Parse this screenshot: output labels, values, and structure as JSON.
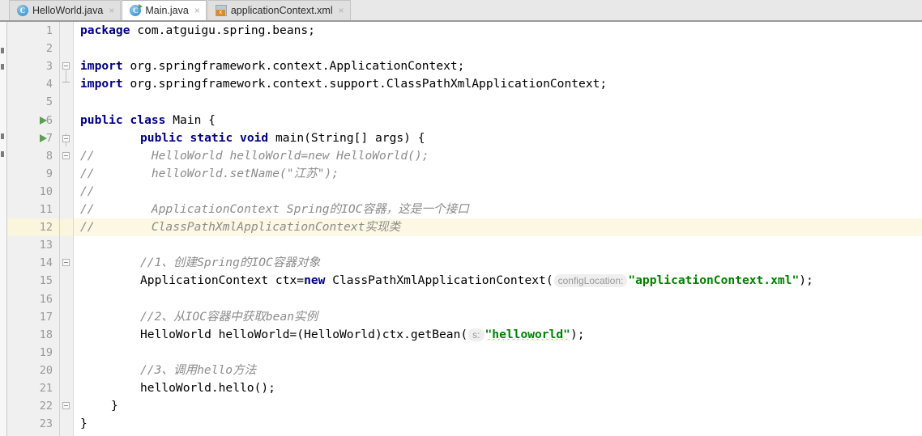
{
  "window": {
    "app": "IntelliJ IDEA Editor",
    "accent_keyword": "#000080",
    "accent_string": "#008000",
    "accent_comment": "#8c8c8c",
    "caret_line_color": "#fcf8e3",
    "run_marker_color": "#5c9e55"
  },
  "tabs": [
    {
      "label": "HelloWorld.java",
      "icon": "java-class-icon",
      "active": false,
      "close": "×"
    },
    {
      "label": "Main.java",
      "icon": "java-runnable-class-icon",
      "active": true,
      "close": "×"
    },
    {
      "label": "applicationContext.xml",
      "icon": "xml-file-icon",
      "active": false,
      "close": "×"
    }
  ],
  "editor": {
    "file": "Main.java",
    "caret_line": 12,
    "run_marker_lines": [
      6,
      7
    ],
    "line_numbers": [
      "1",
      "2",
      "3",
      "4",
      "5",
      "6",
      "7",
      "8",
      "9",
      "10",
      "11",
      "12",
      "13",
      "14",
      "15",
      "16",
      "17",
      "18",
      "19",
      "20",
      "21",
      "22",
      "23"
    ],
    "lines": [
      {
        "n": 1,
        "indent": 0,
        "text": "package com.atguigu.spring.beans;"
      },
      {
        "n": 2,
        "indent": 0,
        "text": ""
      },
      {
        "n": 3,
        "indent": 0,
        "text": "import org.springframework.context.ApplicationContext;"
      },
      {
        "n": 4,
        "indent": 0,
        "text": "import org.springframework.context.support.ClassPathXmlApplicationContext;"
      },
      {
        "n": 5,
        "indent": 0,
        "text": ""
      },
      {
        "n": 6,
        "indent": 0,
        "text": "public class Main {"
      },
      {
        "n": 7,
        "indent": 1,
        "text": "public static void main(String[] args) {"
      },
      {
        "n": 8,
        "indent": 0,
        "text": "//        HelloWorld helloWorld=new HelloWorld();"
      },
      {
        "n": 9,
        "indent": 0,
        "text": "//        helloWorld.setName(\"江苏\");"
      },
      {
        "n": 10,
        "indent": 0,
        "text": "//"
      },
      {
        "n": 11,
        "indent": 0,
        "text": "//        ApplicationContext Spring的IOC容器，这是一个接口"
      },
      {
        "n": 12,
        "indent": 0,
        "text": "//        ClassPathXmlApplicationContext实现类"
      },
      {
        "n": 13,
        "indent": 0,
        "text": ""
      },
      {
        "n": 14,
        "indent": 2,
        "text": "//1、创建Spring的IOC容器对象"
      },
      {
        "n": 15,
        "indent": 2,
        "text": "ApplicationContext ctx=new ClassPathXmlApplicationContext( configLocation: \"applicationContext.xml\");"
      },
      {
        "n": 16,
        "indent": 0,
        "text": ""
      },
      {
        "n": 17,
        "indent": 2,
        "text": "//2、从IOC容器中获取bean实例"
      },
      {
        "n": 18,
        "indent": 2,
        "text": "HelloWorld helloWorld=(HelloWorld)ctx.getBean( s: \"helloworld\");"
      },
      {
        "n": 19,
        "indent": 0,
        "text": ""
      },
      {
        "n": 20,
        "indent": 2,
        "text": "//3、调用hello方法"
      },
      {
        "n": 21,
        "indent": 2,
        "text": "helloWorld.hello();"
      },
      {
        "n": 22,
        "indent": 1,
        "text": "}"
      },
      {
        "n": 23,
        "indent": 0,
        "text": "}"
      }
    ],
    "tokens": {
      "kw_package": "package",
      "kw_import": "import",
      "kw_public": "public",
      "kw_class": "class",
      "kw_static": "static",
      "kw_void": "void",
      "kw_new": "new",
      "pkg_name": "com.atguigu.spring.beans;",
      "import1": "org.springframework.context.ApplicationContext;",
      "import2": "org.springframework.context.support.ClassPathXmlApplicationContext;",
      "class_name": "Main {",
      "main_sig": "main(String[] args) {",
      "cmt8": "//        HelloWorld helloWorld=new HelloWorld();",
      "cmt9": "//        helloWorld.setName(\"江苏\");",
      "cmt10": "//",
      "cmt11": "//        ApplicationContext Spring的IOC容器，这是一个接口",
      "cmt12": "//        ClassPathXmlApplicationContext实现类",
      "cmt14": "//1、创建Spring的IOC容器对象",
      "l15a": "ApplicationContext ctx=",
      "l15b": " ClassPathXmlApplicationContext(",
      "l15hint": "configLocation:",
      "l15str": "\"applicationContext.xml\"",
      "l15end": ");",
      "cmt17": "//2、从IOC容器中获取bean实例",
      "l18a": "HelloWorld helloWorld=(HelloWorld)ctx.getBean(",
      "l18hint": "s:",
      "l18str": "\"helloworld\"",
      "l18end": ");",
      "cmt20": "//3、调用hello方法",
      "l21": "helloWorld.hello();",
      "brace_inner": "}",
      "brace_outer": "}"
    }
  }
}
